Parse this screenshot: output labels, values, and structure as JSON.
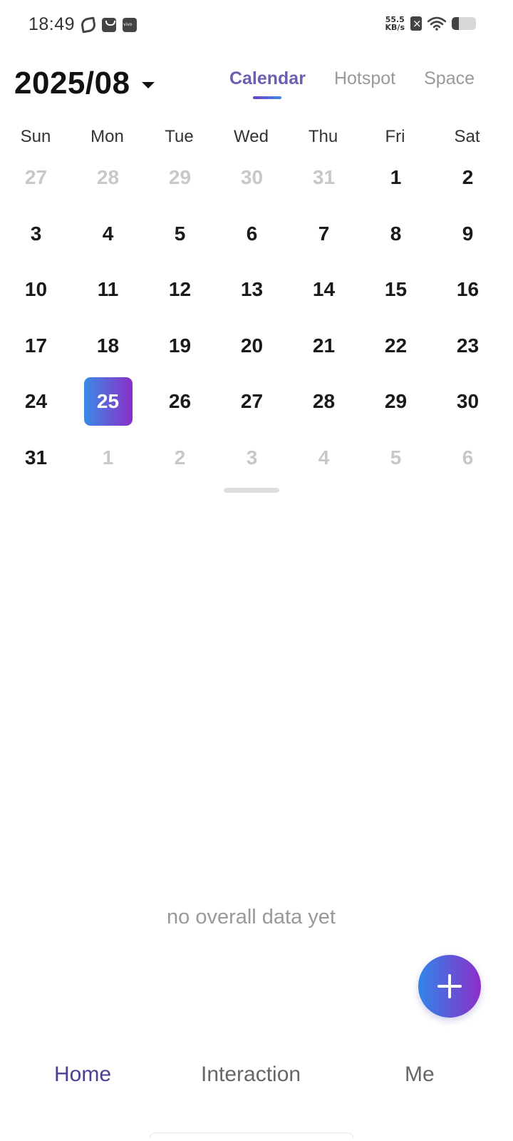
{
  "status_bar": {
    "time": "18:49",
    "net_speed_value": "55.5",
    "net_speed_unit": "KB/s",
    "battery_level": 0.3
  },
  "header": {
    "month_label": "2025/08",
    "tabs": [
      {
        "label": "Calendar",
        "active": true
      },
      {
        "label": "Hotspot",
        "active": false
      },
      {
        "label": "Space",
        "active": false
      }
    ]
  },
  "calendar": {
    "weekdays": [
      "Sun",
      "Mon",
      "Tue",
      "Wed",
      "Thu",
      "Fri",
      "Sat"
    ],
    "weeks": [
      [
        {
          "d": "27",
          "m": true
        },
        {
          "d": "28",
          "m": true
        },
        {
          "d": "29",
          "m": true
        },
        {
          "d": "30",
          "m": true
        },
        {
          "d": "31",
          "m": true
        },
        {
          "d": "1"
        },
        {
          "d": "2"
        }
      ],
      [
        {
          "d": "3"
        },
        {
          "d": "4"
        },
        {
          "d": "5"
        },
        {
          "d": "6"
        },
        {
          "d": "7"
        },
        {
          "d": "8"
        },
        {
          "d": "9"
        }
      ],
      [
        {
          "d": "10"
        },
        {
          "d": "11"
        },
        {
          "d": "12"
        },
        {
          "d": "13"
        },
        {
          "d": "14"
        },
        {
          "d": "15"
        },
        {
          "d": "16"
        }
      ],
      [
        {
          "d": "17"
        },
        {
          "d": "18"
        },
        {
          "d": "19"
        },
        {
          "d": "20"
        },
        {
          "d": "21"
        },
        {
          "d": "22"
        },
        {
          "d": "23"
        }
      ],
      [
        {
          "d": "24"
        },
        {
          "d": "25",
          "s": true
        },
        {
          "d": "26"
        },
        {
          "d": "27"
        },
        {
          "d": "28"
        },
        {
          "d": "29"
        },
        {
          "d": "30"
        }
      ],
      [
        {
          "d": "31"
        },
        {
          "d": "1",
          "m": true
        },
        {
          "d": "2",
          "m": true
        },
        {
          "d": "3",
          "m": true
        },
        {
          "d": "4",
          "m": true
        },
        {
          "d": "5",
          "m": true
        },
        {
          "d": "6",
          "m": true
        }
      ]
    ]
  },
  "empty_state": {
    "text": "no overall data yet"
  },
  "bottom_nav": {
    "items": [
      {
        "label": "Home",
        "active": true
      },
      {
        "label": "Interaction",
        "active": false
      },
      {
        "label": "Me",
        "active": false
      }
    ]
  },
  "colors": {
    "accent": "#6a5fb0",
    "gradient_start": "#3a8be6",
    "gradient_end": "#8a2fc8"
  }
}
